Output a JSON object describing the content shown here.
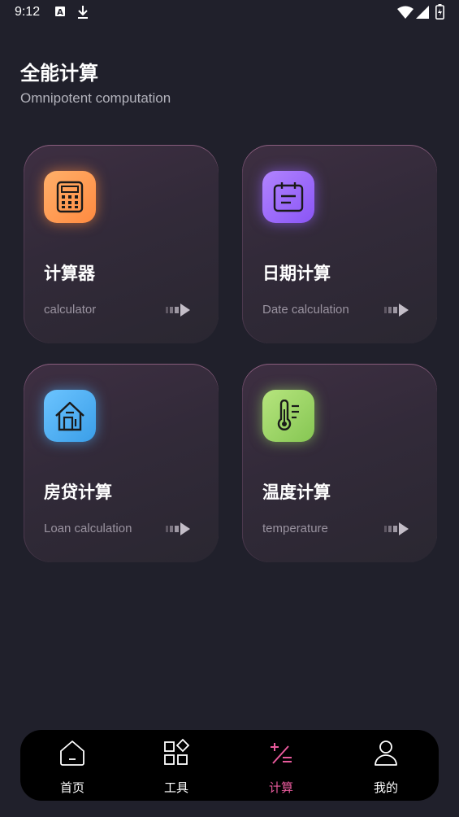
{
  "status_bar": {
    "time": "9:12",
    "icons": [
      "a11y-icon",
      "download-icon",
      "wifi-icon",
      "signal-icon",
      "battery-charging-icon"
    ]
  },
  "header": {
    "title": "全能计算",
    "subtitle": "Omnipotent computation"
  },
  "cards": [
    {
      "title": "计算器",
      "subtitle": "calculator",
      "icon": "calculator-icon",
      "color": "#ff9a4d"
    },
    {
      "title": "日期计算",
      "subtitle": "Date calculation",
      "icon": "calendar-icon",
      "color": "#9b6bff"
    },
    {
      "title": "房贷计算",
      "subtitle": "Loan calculation",
      "icon": "house-icon",
      "color": "#4fb0f0"
    },
    {
      "title": "温度计算",
      "subtitle": "temperature",
      "icon": "thermometer-icon",
      "color": "#9ed36b"
    }
  ],
  "nav": {
    "items": [
      {
        "label": "首页",
        "icon": "home-icon",
        "active": false
      },
      {
        "label": "工具",
        "icon": "tools-grid-icon",
        "active": false
      },
      {
        "label": "计算",
        "icon": "calc-ops-icon",
        "active": true
      },
      {
        "label": "我的",
        "icon": "user-icon",
        "active": false
      }
    ],
    "active_color": "#e85a9c"
  }
}
